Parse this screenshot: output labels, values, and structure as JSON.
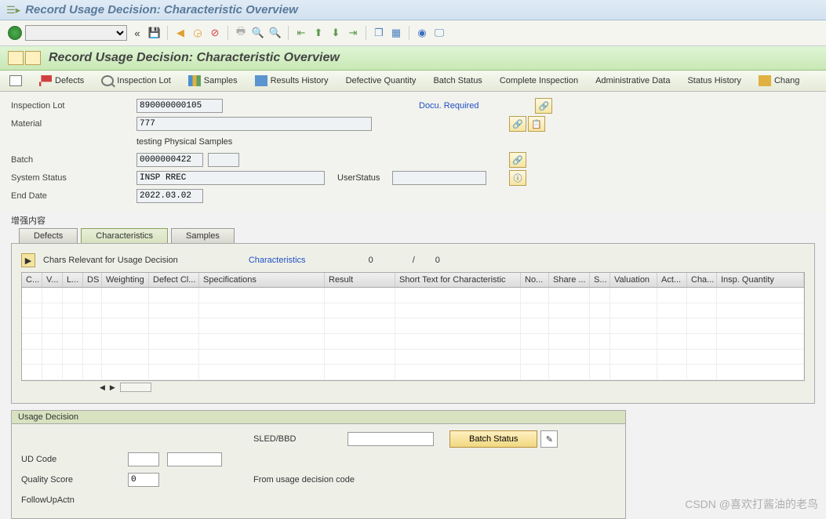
{
  "window": {
    "title": "Record Usage Decision: Characteristic Overview"
  },
  "header": {
    "title": "Record Usage Decision: Characteristic Overview"
  },
  "app_toolbar": {
    "defects": "Defects",
    "inspection_lot": "Inspection Lot",
    "samples": "Samples",
    "results_history": "Results History",
    "defective_qty": "Defective Quantity",
    "batch_status": "Batch Status",
    "complete_insp": "Complete Inspection",
    "admin_data": "Administrative Data",
    "status_history": "Status History",
    "chang": "Chang"
  },
  "form": {
    "inspection_lot_lbl": "Inspection Lot",
    "inspection_lot": "890000000105",
    "docu_required": "Docu. Required",
    "material_lbl": "Material",
    "material": "777",
    "material_desc": "testing Physical Samples",
    "batch_lbl": "Batch",
    "batch": "0000000422",
    "system_status_lbl": "System Status",
    "system_status": "INSP RREC",
    "user_status_lbl": "UserStatus",
    "user_status": "",
    "end_date_lbl": "End Date",
    "end_date": "2022.03.02",
    "enhance": "增强内容"
  },
  "tabs": {
    "defects": "Defects",
    "characteristics": "Characteristics",
    "samples": "Samples"
  },
  "chars_panel": {
    "title": "Chars Relevant for Usage Decision",
    "link": "Characteristics",
    "count1": "0",
    "sep": "/",
    "count2": "0",
    "cols": {
      "c": "C...",
      "v": "V...",
      "l": "L...",
      "ds": "DS",
      "weighting": "Weighting",
      "defect_cl": "Defect Cl...",
      "specs": "Specifications",
      "result": "Result",
      "short_text": "Short Text for Characteristic",
      "no": "No...",
      "share": "Share ...",
      "s": "S...",
      "valuation": "Valuation",
      "act": "Act...",
      "cha": "Cha...",
      "insp_qty": "Insp. Quantity"
    }
  },
  "ud": {
    "legend": "Usage Decision",
    "sled_lbl": "SLED/BBD",
    "sled": "",
    "batch_status_btn": "Batch Status",
    "ud_code_lbl": "UD Code",
    "ud_code1": "",
    "ud_code2": "",
    "quality_score_lbl": "Quality Score",
    "quality_score": "0",
    "from_code": "From usage decision code",
    "followup_lbl": "FollowUpActn"
  },
  "watermark": "CSDN @喜欢打酱油的老鸟"
}
